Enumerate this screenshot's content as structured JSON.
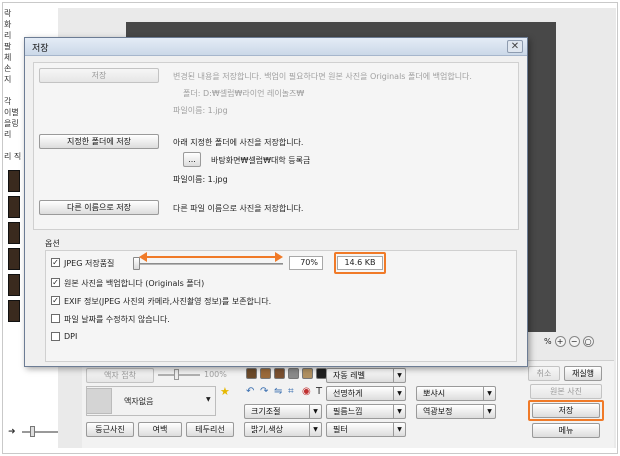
{
  "background": {
    "left_strip_text": [
      "락",
      "화",
      "리",
      "팔",
      "체",
      "손",
      "지",
      "",
      "각",
      "이별",
      "을링",
      "리",
      "",
      "리 직"
    ]
  },
  "zoom": {
    "label": "%",
    "icons": [
      "zoom-in-icon",
      "zoom-out-icon",
      "search-icon"
    ]
  },
  "bottom_panel": {
    "frame_label": "액자 접착",
    "frame_percent": "100%",
    "frame_select": "액자없음",
    "rounded_photo": "둥근사진",
    "margin": "여백",
    "border_line": "테두리선",
    "auto_level": "자동 레벨",
    "sharpen": "선명하게",
    "resize": "크기조절",
    "filter_feel": "필름느낌",
    "brightness_color": "밝기,색상",
    "filter": "필터",
    "blur": "뽀샤시",
    "backlight": "역광보정",
    "cancel": "취소",
    "redo": "재실행",
    "original_photo": "원본 사진",
    "save": "저장",
    "menu": "메뉴"
  },
  "dialog": {
    "title": "저장",
    "close": "✕",
    "save_btn": "저장",
    "save_desc": "변경된 내용을 저장합니다. 백업이 필요하다면 원본 사진을 Originals 폴더에 백업합니다.",
    "folder_label": "폴더: D:₩셀럽₩라이언 레이놀즈₩",
    "filename_label_1": "파일이름: 1.jpg",
    "save_to_folder_btn": "지정한 폴더에 저장",
    "save_to_folder_desc": "아래 지정한 폴더에 사진을 저장합니다.",
    "browse_btn": "...",
    "target_folder": "바탕화면₩셀럽₩대학 등록금",
    "filename_label_2": "파일이름: 1.jpg",
    "save_as_btn": "다른 이름으로 저장",
    "save_as_desc": "다른 파일 이름으로 사진을 저장합니다.",
    "options_label": "옵션",
    "jpeg_quality_label": "JPEG 저장품질",
    "jpeg_quality_value": "70%",
    "jpeg_quality": 0.7,
    "file_size": "14.6 KB",
    "backup_original": "원본 사진을 백업합니다 (Originals 폴더)",
    "keep_exif": "EXIF 정보(JPEG 사진의 카메라,사진촬영 정보)를 보존합니다.",
    "keep_date": "파일 날짜를 수정하지 않습니다.",
    "dpi": "DPI",
    "checks": {
      "jpeg": "✓",
      "backup": "✓",
      "exif": "✓",
      "date": "",
      "dpi": ""
    }
  },
  "colors": {
    "highlight": "#f07a28",
    "title_bar": "#cbd8e8"
  }
}
